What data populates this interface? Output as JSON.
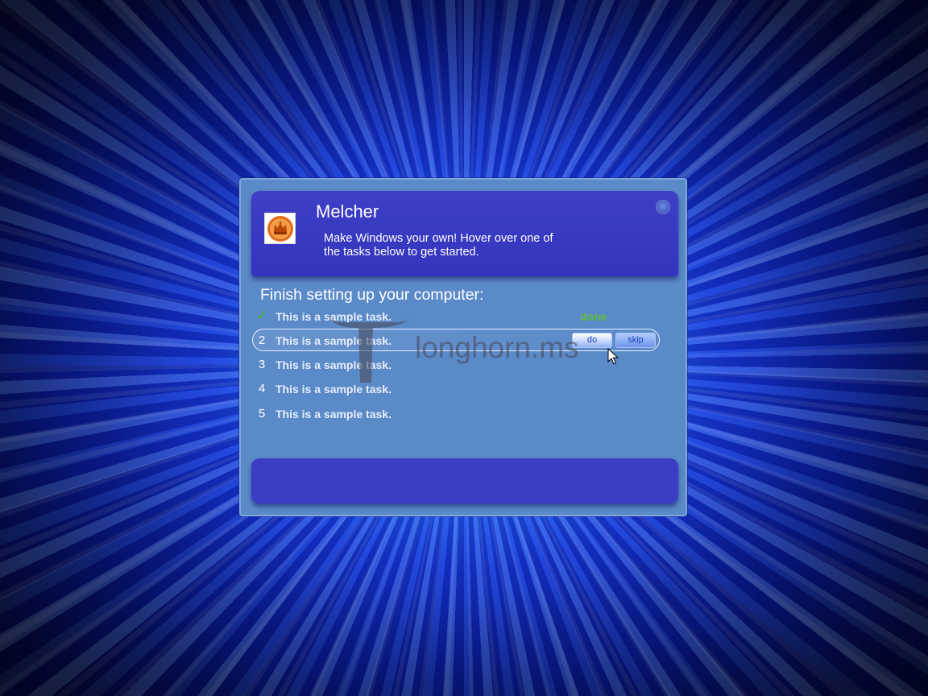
{
  "window": {
    "app_title": "Melcher",
    "description": "Make Windows your own! Hover over one of the tasks below to get started.",
    "section_title": "Finish setting up your computer:"
  },
  "tasks": [
    {
      "marker": "✓",
      "label": "This is a sample task.",
      "status": "done"
    },
    {
      "marker": "2",
      "label": "This is a sample task.",
      "do_label": "do",
      "skip_label": "skip"
    },
    {
      "marker": "3",
      "label": "This is a sample task."
    },
    {
      "marker": "4",
      "label": "This is a sample task."
    },
    {
      "marker": "5",
      "label": "This is a sample task."
    }
  ],
  "watermark": {
    "text": "longhorn.ms"
  },
  "icons": {
    "app": "crown-emblem-icon",
    "close": "close-orb-icon",
    "done": "checkmark-icon",
    "pointer": "mouse-pointer-icon"
  },
  "colors": {
    "panel": "#5b8ac9",
    "header": "#3a3ec4",
    "done_green": "#5fbd3a"
  }
}
